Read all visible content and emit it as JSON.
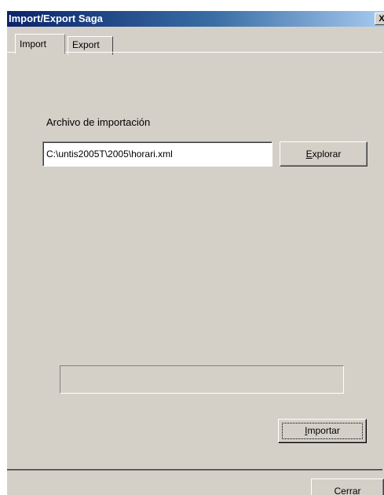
{
  "window": {
    "title": "Import/Export Saga",
    "close_glyph": "X"
  },
  "tabs": [
    {
      "label": "Import",
      "selected": true
    },
    {
      "label": "Export",
      "selected": false
    }
  ],
  "import_panel": {
    "file_label": "Archivo de importación",
    "file_path": "C:\\untis2005T\\2005\\horari.xml",
    "browse_button": {
      "mnemonic": "E",
      "rest": "xplorar"
    },
    "progress": 0,
    "import_button": {
      "mnemonic": "I",
      "rest": "mportar"
    }
  },
  "footer": {
    "close_button": {
      "mnemonic": "C",
      "rest": "errar"
    }
  },
  "colors": {
    "title_gradient_start": "#0a246a",
    "title_gradient_end": "#a6caf0",
    "face": "#d4d0c8"
  }
}
